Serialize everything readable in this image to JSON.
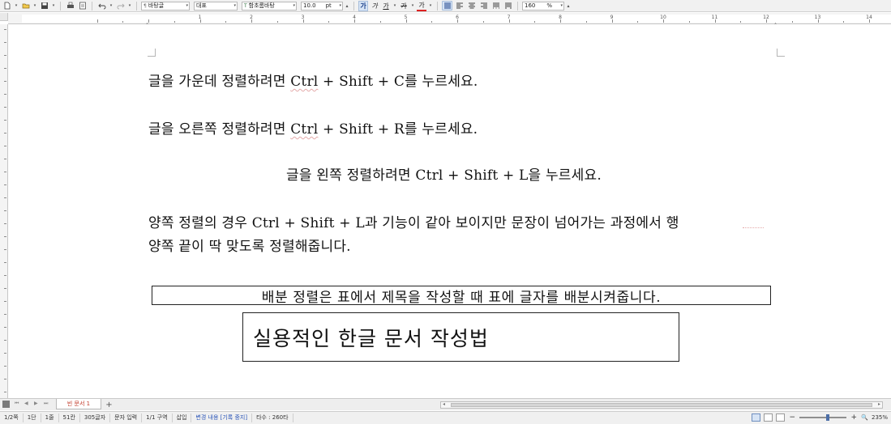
{
  "toolbar": {
    "style_name": "바탕글",
    "font_lang": "대표",
    "font_name": "함초롬바탕",
    "font_size": "10.0",
    "font_unit": "pt",
    "zoom_value": "160",
    "zoom_unit": "%",
    "bold_glyph": "가",
    "italic_glyph": "가",
    "underline_glyph": "가",
    "strike_glyph": "가",
    "color_glyph": "가"
  },
  "ruler": {
    "numbers": [
      "1",
      "2",
      "3",
      "4",
      "5",
      "6",
      "7",
      "8",
      "9",
      "10",
      "11",
      "12",
      "13",
      "14",
      "15",
      "16"
    ]
  },
  "document": {
    "p1": {
      "before": "글을 가운데 정렬하려면 ",
      "ctrl": "Ctrl",
      "after": " + Shift + C를 누르세요."
    },
    "p2": {
      "before": "글을 오른쪽 정렬하려면 ",
      "ctrl": "Ctrl",
      "after": " + Shift + R를 누르세요."
    },
    "p3": "글을 왼쪽 정렬하려면 Ctrl + Shift + L을 누르세요.",
    "p4_line1": "양쪽 정렬의 경우 Ctrl + Shift + L과 기능이 같아 보이지만 문장이 넘어가는 과정에서 행",
    "p4_line2": "양쪽 끝이 딱 맞도록 정렬해줍니다.",
    "box1": "배분 정렬은 표에서 제목을 작성할 때 표에 글자를 배분시켜줍니다.",
    "box2": "실용적인 한글 문서 작성법"
  },
  "tabs": {
    "doc_tab": "빈 문서 1",
    "add_tab": "+"
  },
  "status": {
    "page": "1/2쪽",
    "column": "1단",
    "line": "1줄",
    "col_pos": "51칸",
    "char_count": "305글자",
    "input_mode": "문자 입력",
    "section": "1/1 구역",
    "insert_mode": "삽입",
    "track_changes": "변경 내용 [기록 중지]",
    "typing_speed": "타수 : 260타",
    "zoom": "235%"
  }
}
